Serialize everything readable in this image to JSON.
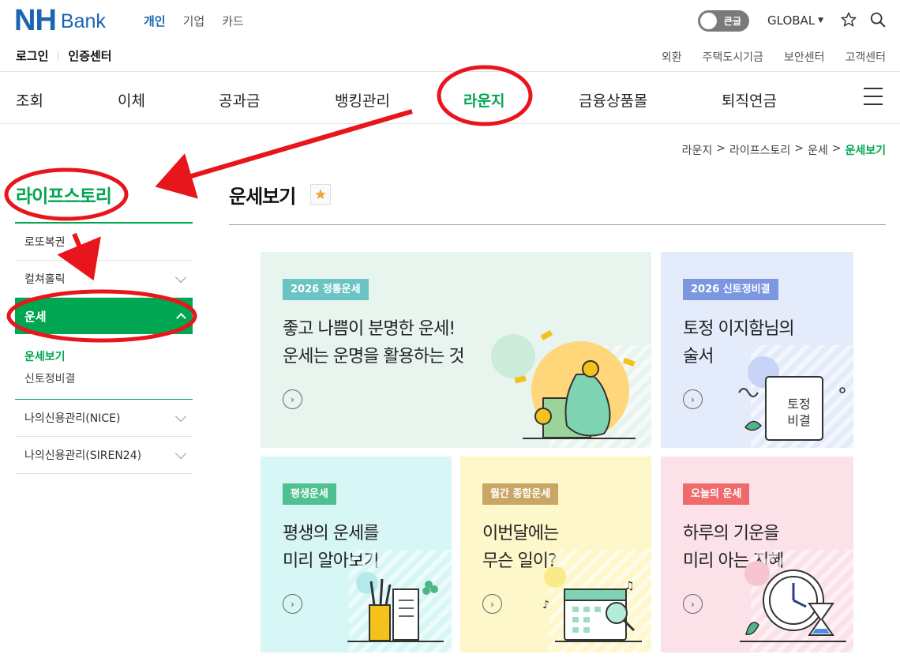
{
  "header": {
    "logo_nh": "NH",
    "logo_bank": "Bank",
    "tabs": [
      {
        "label": "개인",
        "active": true
      },
      {
        "label": "기업",
        "active": false
      },
      {
        "label": "카드",
        "active": false
      }
    ],
    "toggle_label": "큰글",
    "global_label": "GLOBAL",
    "login_label": "로그인",
    "cert_label": "인증센터",
    "util_links": [
      "외환",
      "주택도시기금",
      "보안센터",
      "고객센터"
    ]
  },
  "gnb": {
    "items": [
      "조회",
      "이체",
      "공과금",
      "뱅킹관리",
      "라운지",
      "금융상품몰",
      "퇴직연금"
    ],
    "active": "라운지"
  },
  "breadcrumb": [
    "라운지",
    "라이프스토리",
    "운세",
    "운세보기"
  ],
  "breadcrumb_sep": ">",
  "sidebar": {
    "title": "라이프스토리",
    "items": [
      "로또복권",
      "컬쳐홀릭",
      "운세",
      "나의신용관리(NICE)",
      "나의신용관리(SIREN24)"
    ],
    "active_item": "운세",
    "sub_items": [
      "운세보기",
      "신토정비결"
    ],
    "active_sub": "운세보기"
  },
  "page_title": "운세보기",
  "cards": [
    {
      "badge": "2026 정통운세",
      "line1": "좋고 나쁨이 분명한 운세!",
      "line2": "운세는 운명을 활용하는 것",
      "bg": "#e8f5ef",
      "badge_color": "#6cc3c3"
    },
    {
      "badge": "2026 신토정비결",
      "line1": "토정 이지함님의",
      "line2": "술서",
      "bg": "#e4ebfb",
      "badge_color": "#7c97e0",
      "book_text1": "토정",
      "book_text2": "비결"
    },
    {
      "badge": "평생운세",
      "line1": "평생의 운세를",
      "line2": "미리 알아보기",
      "bg": "#d7f6f6",
      "badge_color": "#4fc08f"
    },
    {
      "badge": "월간 종합운세",
      "line1": "이번달에는",
      "line2": "무슨 일이?",
      "bg": "#fdf7c9",
      "badge_color": "#c9a666"
    },
    {
      "badge": "오늘의 운세",
      "line1": "하루의 기운을",
      "line2": "미리 아는 지혜",
      "bg": "#fbe1e8",
      "badge_color": "#ef6b6b"
    }
  ],
  "colors": {
    "brand_blue": "#1a64b3",
    "brand_green": "#00a651",
    "annotation_red": "#e8161c"
  }
}
